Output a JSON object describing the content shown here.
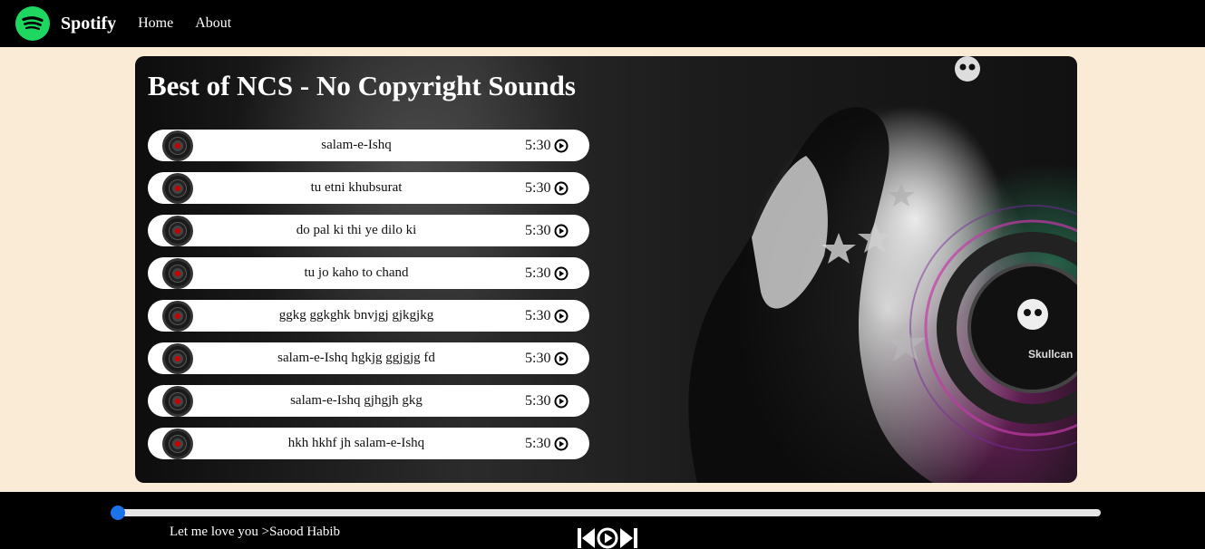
{
  "navbar": {
    "brand": "Spotify",
    "links": [
      "Home",
      "About"
    ],
    "logo_icon": "spotify-logo-icon",
    "logo_color": "#1ed760"
  },
  "playlist": {
    "title": "Best of NCS - No Copyright Sounds",
    "songs": [
      {
        "name": "salam-e-Ishq",
        "duration": "5:30"
      },
      {
        "name": "tu etni khubsurat",
        "duration": "5:30"
      },
      {
        "name": "do pal ki thi ye dilo ki",
        "duration": "5:30"
      },
      {
        "name": "tu jo kaho to chand",
        "duration": "5:30"
      },
      {
        "name": "ggkg ggkghk bnvjgj gjkgjkg",
        "duration": "5:30"
      },
      {
        "name": "salam-e-Ishq hgkjg ggjgjg fd",
        "duration": "5:30"
      },
      {
        "name": "salam-e-Ishq gjhgjh gkg",
        "duration": "5:30"
      },
      {
        "name": "hkh hkhf jh salam-e-Ishq",
        "duration": "5:30"
      }
    ]
  },
  "player": {
    "now_playing": "Let me love you >Saood Habib",
    "progress_fraction": 0.0,
    "controls": [
      "previous-icon",
      "play-icon",
      "next-icon"
    ],
    "accent": "#1a73e8"
  },
  "colors": {
    "page_background": "#faebd7",
    "bar_background": "#000000"
  }
}
